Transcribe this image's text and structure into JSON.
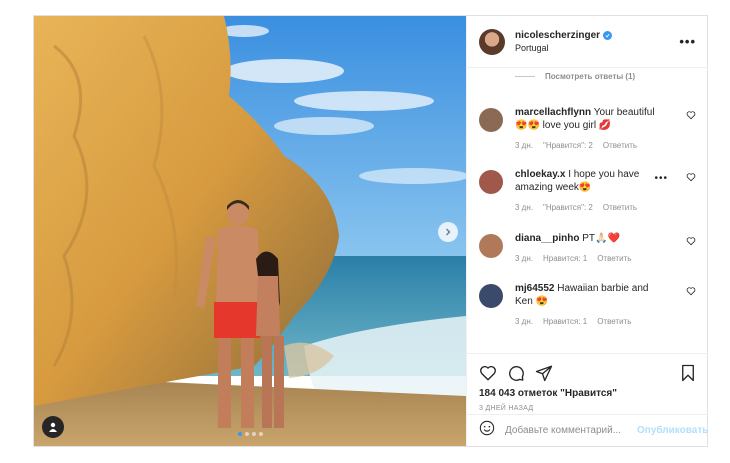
{
  "post": {
    "username": "nicolescherzinger",
    "location": "Portugal",
    "view_replies": "Посмотреть ответы (1)",
    "comments": [
      {
        "user": "marcellachflynn",
        "text": "Your beautiful 😍😍 love you girl 💋",
        "time": "3 дн.",
        "likes": "\"Нравится\": 2",
        "reply": "Ответить",
        "avatar_color": "#8a6a55"
      },
      {
        "user": "chloekay.x",
        "text": "I hope you have amazing week😍",
        "time": "3 дн.",
        "likes": "\"Нравится\": 2",
        "reply": "Ответить",
        "avatar_color": "#a0584a"
      },
      {
        "user": "diana__pinho",
        "text": "PT🙏🏻❤️",
        "time": "3 дн.",
        "likes": "Нравится: 1",
        "reply": "Ответить",
        "avatar_color": "#b07a5a"
      },
      {
        "user": "mj64552",
        "text": "Hawaiian barbie and Ken 😍",
        "time": "3 дн.",
        "likes": "Нравится: 1",
        "reply": "Ответить",
        "avatar_color": "#3a4a6a"
      }
    ],
    "likes_text": "184 043 отметок \"Нравится\"",
    "posted_ago": "3 ДНЕЙ НАЗАД",
    "add_comment_placeholder": "Добавьте комментарий...",
    "publish_label": "Опубликовать",
    "carousel": {
      "count": 4,
      "active": 0
    }
  }
}
